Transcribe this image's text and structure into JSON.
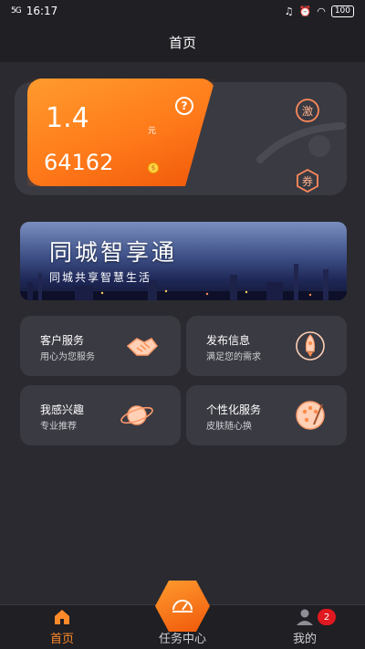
{
  "status_bar": {
    "signal": "5G",
    "time": "16:17",
    "battery": "100"
  },
  "header": {
    "title": "首页"
  },
  "wallet": {
    "balance": "1.4",
    "balance_unit": "元",
    "points": "64162",
    "coin_symbol": "$",
    "accent_color": "#ff7a1a"
  },
  "banner": {
    "title": "同城智享通",
    "subtitle": "同城共享智慧生活"
  },
  "services": [
    {
      "title": "客户服务",
      "subtitle": "用心为您服务",
      "icon": "handshake-icon"
    },
    {
      "title": "发布信息",
      "subtitle": "满足您的需求",
      "icon": "rocket-icon"
    },
    {
      "title": "我感兴趣",
      "subtitle": "专业推荐",
      "icon": "planet-icon"
    },
    {
      "title": "个性化服务",
      "subtitle": "皮肤随心换",
      "icon": "palette-icon"
    }
  ],
  "nav": {
    "home": "首页",
    "task": "任务中心",
    "mine": "我的",
    "mine_badge": "2"
  }
}
